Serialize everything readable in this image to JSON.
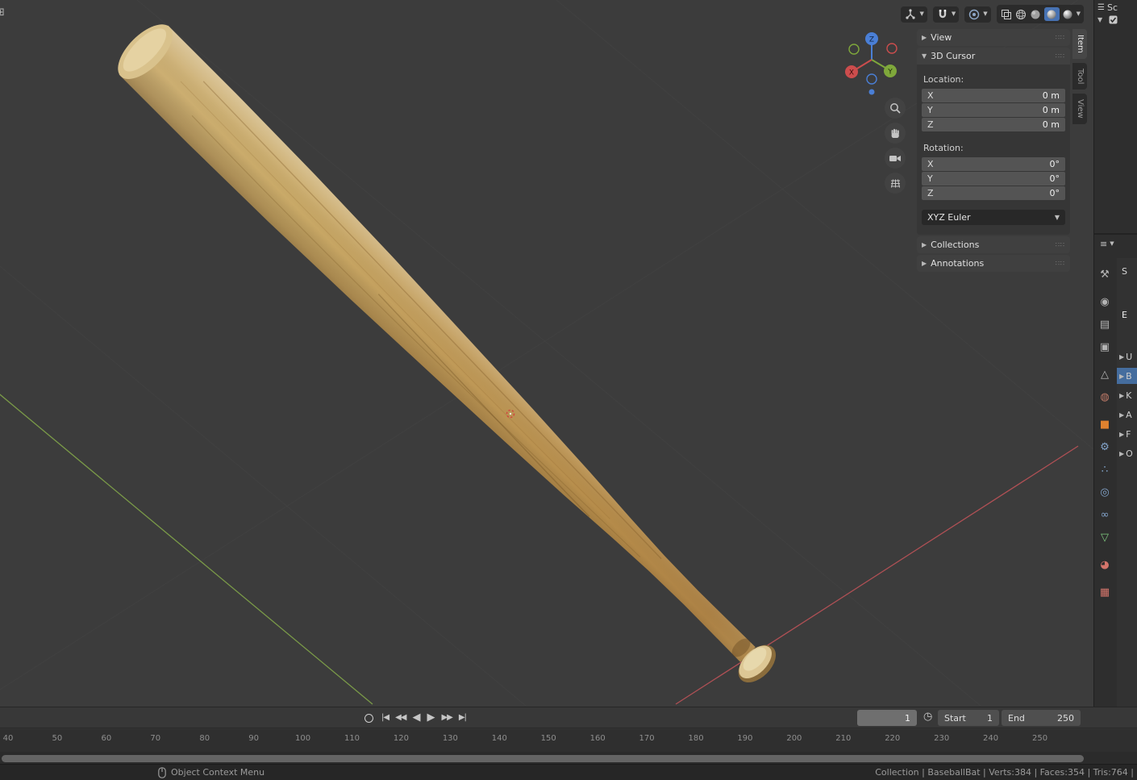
{
  "viewport": {
    "gizmo": {
      "x": "X",
      "y": "Y",
      "z": "Z"
    },
    "sidebar": {
      "tabs": [
        {
          "label": "Item",
          "active": true
        },
        {
          "label": "Tool",
          "active": false
        },
        {
          "label": "View",
          "active": false
        }
      ],
      "panels": {
        "view": "View",
        "cursor": "3D Cursor",
        "collections": "Collections",
        "annotations": "Annotations"
      },
      "cursor": {
        "location_label": "Location:",
        "location": [
          {
            "axis": "X",
            "value": "0 m"
          },
          {
            "axis": "Y",
            "value": "0 m"
          },
          {
            "axis": "Z",
            "value": "0 m"
          }
        ],
        "rotation_label": "Rotation:",
        "rotation": [
          {
            "axis": "X",
            "value": "0°"
          },
          {
            "axis": "Y",
            "value": "0°"
          },
          {
            "axis": "Z",
            "value": "0°"
          }
        ],
        "euler_mode": "XYZ Euler"
      }
    }
  },
  "outliner": {
    "scene_label": "Sc"
  },
  "properties": {
    "tabs": [
      {
        "name": "tool",
        "glyph": "⚒",
        "color": "#b4b4b4",
        "gap": false,
        "active": false
      },
      {
        "name": "render",
        "glyph": "◉",
        "color": "#b4b4b4",
        "gap": true,
        "active": false
      },
      {
        "name": "output",
        "glyph": "▤",
        "color": "#b4b4b4",
        "gap": false,
        "active": false
      },
      {
        "name": "view-layer",
        "glyph": "▣",
        "color": "#b4b4b4",
        "gap": false,
        "active": false
      },
      {
        "name": "scene",
        "glyph": "△",
        "color": "#b4b4b4",
        "gap": true,
        "active": false
      },
      {
        "name": "world",
        "glyph": "◍",
        "color": "#bf7a68",
        "gap": false,
        "active": false
      },
      {
        "name": "object",
        "glyph": "■",
        "color": "#e0822f",
        "gap": true,
        "active": false
      },
      {
        "name": "modifiers",
        "glyph": "⚙",
        "color": "#84a5cc",
        "gap": false,
        "active": false
      },
      {
        "name": "particles",
        "glyph": "∴",
        "color": "#84a5cc",
        "gap": false,
        "active": false
      },
      {
        "name": "physics",
        "glyph": "◎",
        "color": "#84a5cc",
        "gap": false,
        "active": false
      },
      {
        "name": "constraints",
        "glyph": "∞",
        "color": "#84a5cc",
        "gap": false,
        "active": false
      },
      {
        "name": "object-data",
        "glyph": "▽",
        "color": "#7fc97f",
        "gap": false,
        "active": false
      },
      {
        "name": "material",
        "glyph": "◕",
        "color": "#d4756b",
        "gap": true,
        "active": false
      },
      {
        "name": "texture",
        "glyph": "▦",
        "color": "#d4756b",
        "gap": true,
        "active": false
      }
    ],
    "partial_top": [
      "S",
      "E"
    ],
    "partial_rows": [
      {
        "label": "U",
        "active": false
      },
      {
        "label": "B",
        "active": true
      },
      {
        "label": "K",
        "active": false
      },
      {
        "label": "A",
        "active": false
      },
      {
        "label": "F",
        "active": false
      },
      {
        "label": "O",
        "active": false
      }
    ]
  },
  "timeline": {
    "playback": [
      {
        "name": "jump-to-start",
        "glyph": "|◀"
      },
      {
        "name": "prev-keyframe",
        "glyph": "◀◀"
      },
      {
        "name": "play-reverse",
        "glyph": "◀"
      },
      {
        "name": "play",
        "glyph": "▶"
      },
      {
        "name": "next-keyframe",
        "glyph": "▶▶"
      },
      {
        "name": "jump-to-end",
        "glyph": "▶|"
      }
    ],
    "current_frame": "1",
    "start_label": "Start",
    "start_value": "1",
    "end_label": "End",
    "end_value": "250",
    "ticks": [
      40,
      50,
      60,
      70,
      80,
      90,
      100,
      110,
      120,
      130,
      140,
      150,
      160,
      170,
      180,
      190,
      200,
      210,
      220,
      230,
      240,
      250
    ]
  },
  "statusbar": {
    "left": "Object Context Menu",
    "right": "Collection | BaseballBat | Verts:384 | Faces:354 | Tris:764 |"
  }
}
